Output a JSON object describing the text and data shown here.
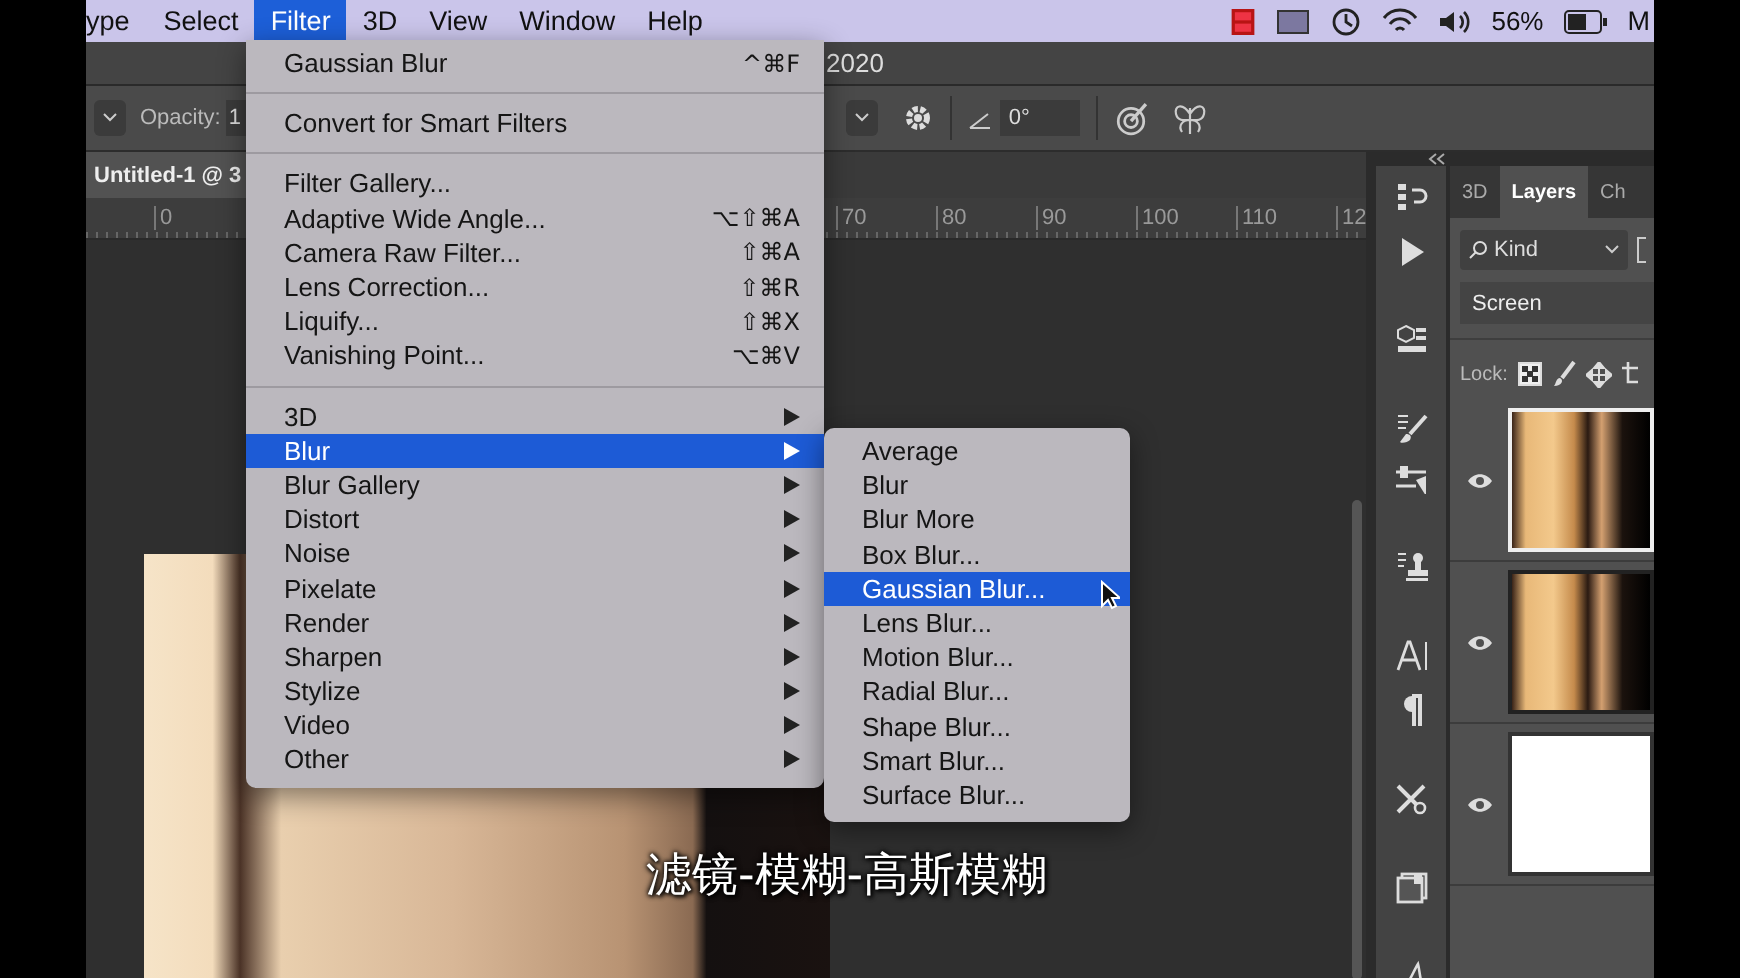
{
  "menu_bar": {
    "items": [
      {
        "label": "ype",
        "selected": false
      },
      {
        "label": "Select",
        "selected": false
      },
      {
        "label": "Filter",
        "selected": true
      },
      {
        "label": "3D",
        "selected": false
      },
      {
        "label": "View",
        "selected": false
      },
      {
        "label": "Window",
        "selected": false
      },
      {
        "label": "Help",
        "selected": false
      }
    ],
    "battery": "56%",
    "clipped_item": "M"
  },
  "title_bar": {
    "title": "2020"
  },
  "options_bar": {
    "opacity_label": "Opacity:",
    "opacity_value": "1",
    "angle_value": "0°"
  },
  "document_tab": {
    "title": "Untitled-1 @ 3"
  },
  "ruler": {
    "ticks": [
      "0",
      "70",
      "80",
      "90",
      "100",
      "110",
      "12"
    ]
  },
  "filter_menu": {
    "groups": [
      [
        {
          "label": "Gaussian Blur",
          "shortcut": "^⌘F",
          "submenu": false,
          "selected": false
        }
      ],
      [
        {
          "label": "Convert for Smart Filters",
          "submenu": false,
          "selected": false
        }
      ],
      [
        {
          "label": "Filter Gallery...",
          "submenu": false,
          "selected": false
        },
        {
          "label": "Adaptive Wide Angle...",
          "shortcut": "⌥⇧⌘A",
          "submenu": false,
          "selected": false
        },
        {
          "label": "Camera Raw Filter...",
          "shortcut": "⇧⌘A",
          "submenu": false,
          "selected": false
        },
        {
          "label": "Lens Correction...",
          "shortcut": "⇧⌘R",
          "submenu": false,
          "selected": false
        },
        {
          "label": "Liquify...",
          "shortcut": "⇧⌘X",
          "submenu": false,
          "selected": false
        },
        {
          "label": "Vanishing Point...",
          "shortcut": "⌥⌘V",
          "submenu": false,
          "selected": false
        }
      ],
      [
        {
          "label": "3D",
          "submenu": true,
          "selected": false
        },
        {
          "label": "Blur",
          "submenu": true,
          "selected": true
        },
        {
          "label": "Blur Gallery",
          "submenu": true,
          "selected": false
        },
        {
          "label": "Distort",
          "submenu": true,
          "selected": false
        },
        {
          "label": "Noise",
          "submenu": true,
          "selected": false
        },
        {
          "label": "Pixelate",
          "submenu": true,
          "selected": false
        },
        {
          "label": "Render",
          "submenu": true,
          "selected": false
        },
        {
          "label": "Sharpen",
          "submenu": true,
          "selected": false
        },
        {
          "label": "Stylize",
          "submenu": true,
          "selected": false
        },
        {
          "label": "Video",
          "submenu": true,
          "selected": false
        },
        {
          "label": "Other",
          "submenu": true,
          "selected": false
        }
      ]
    ]
  },
  "blur_submenu": {
    "items": [
      {
        "label": "Average",
        "selected": false
      },
      {
        "label": "Blur",
        "selected": false
      },
      {
        "label": "Blur More",
        "selected": false
      },
      {
        "label": "Box Blur...",
        "selected": false
      },
      {
        "label": "Gaussian Blur...",
        "selected": true
      },
      {
        "label": "Lens Blur...",
        "selected": false
      },
      {
        "label": "Motion Blur...",
        "selected": false
      },
      {
        "label": "Radial Blur...",
        "selected": false
      },
      {
        "label": "Shape Blur...",
        "selected": false
      },
      {
        "label": "Smart Blur...",
        "selected": false
      },
      {
        "label": "Surface Blur...",
        "selected": false
      }
    ]
  },
  "layers_panel": {
    "tabs": [
      {
        "label": "3D",
        "selected": false
      },
      {
        "label": "Layers",
        "selected": true
      },
      {
        "label": "Ch",
        "selected": false
      }
    ],
    "filter_kind": "Kind",
    "blend_mode": "Screen",
    "lock_label": "Lock:",
    "layers": [
      {
        "kind": "photo",
        "selected": true,
        "visible": true
      },
      {
        "kind": "photo",
        "selected": false,
        "visible": true
      },
      {
        "kind": "white",
        "selected": false,
        "visible": true
      }
    ]
  },
  "subtitle": "滤镜-模糊-高斯模糊"
}
